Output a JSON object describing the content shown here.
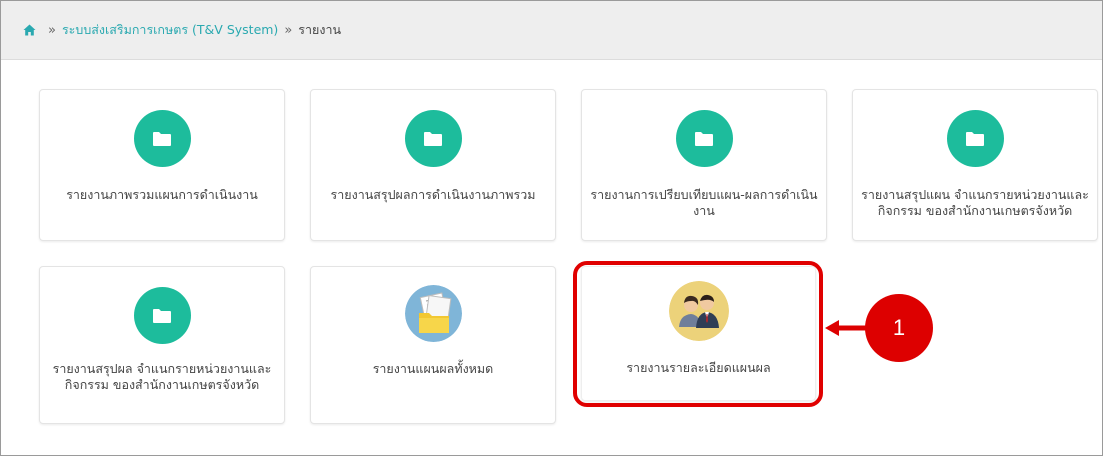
{
  "breadcrumb": {
    "home_icon": "home-icon",
    "separator": "»",
    "system_link": "ระบบส่งเสริมการเกษตร (T&V System)",
    "current": "รายงาน"
  },
  "cards": [
    {
      "icon": "folder-icon",
      "label": "รายงานภาพรวมแผนการดำเนินงาน"
    },
    {
      "icon": "folder-icon",
      "label": "รายงานสรุปผลการดำเนินงานภาพรวม"
    },
    {
      "icon": "folder-icon",
      "label_line1": "รายงานการเปรียบเทียบแผน-ผลการดำเนิน",
      "label_line2": "งาน"
    },
    {
      "icon": "folder-icon",
      "label_line1": "รายงานสรุปแผน จำแนกรายหน่วยงานและ",
      "label_line2": "กิจกรรม ของสำนักงานเกษตรจังหวัด"
    },
    {
      "icon": "folder-icon",
      "label_line1": "รายงานสรุปผล จำแนกรายหน่วยงานและ",
      "label_line2": "กิจกรรม ของสำนักงานเกษตรจังหวัด"
    },
    {
      "icon": "documents-folder-icon",
      "label": "รายงานแผนผลทั้งหมด"
    },
    {
      "icon": "people-icon",
      "label": "รายงานรายละเอียดแผนผล"
    }
  ],
  "callout": {
    "number": "1"
  },
  "colors": {
    "accent": "#1dbc9c",
    "link": "#2aa9b0",
    "highlight": "#e00000"
  }
}
